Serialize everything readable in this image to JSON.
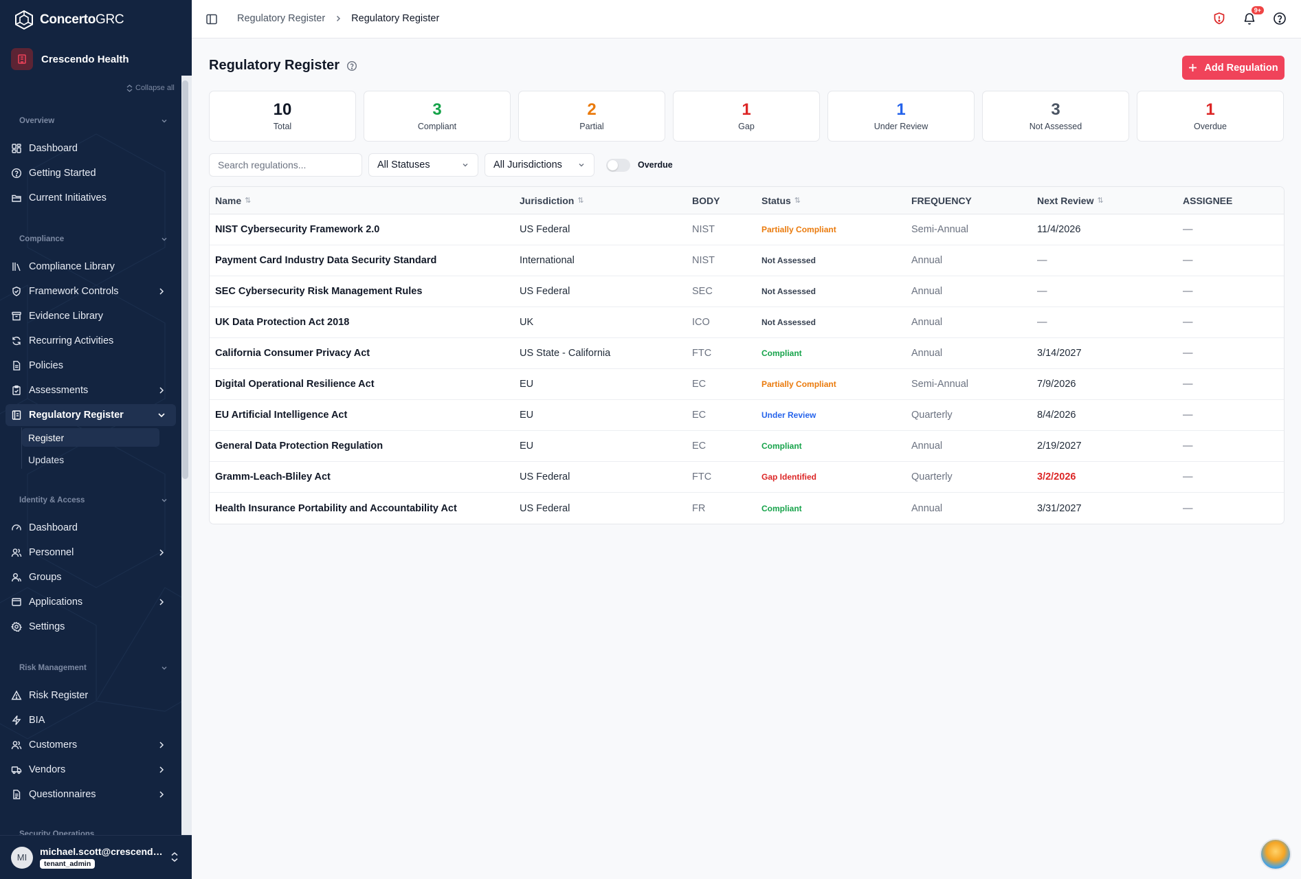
{
  "brand": {
    "name_bold": "Concerto",
    "name_thin": "GRC"
  },
  "tenant": {
    "name": "Crescendo Health"
  },
  "sidebar": {
    "collapse_all": "Collapse all",
    "sections": {
      "overview": "Overview",
      "compliance": "Compliance",
      "identity": "Identity & Access",
      "risk": "Risk Management",
      "security": "Security Operations"
    },
    "items": {
      "dashboard": "Dashboard",
      "getting_started": "Getting Started",
      "current_initiatives": "Current Initiatives",
      "compliance_library": "Compliance Library",
      "framework_controls": "Framework Controls",
      "evidence_library": "Evidence Library",
      "recurring_activities": "Recurring Activities",
      "policies": "Policies",
      "assessments": "Assessments",
      "regulatory_register": "Regulatory Register",
      "register": "Register",
      "updates": "Updates",
      "ia_dashboard": "Dashboard",
      "personnel": "Personnel",
      "groups": "Groups",
      "applications": "Applications",
      "settings": "Settings",
      "risk_register": "Risk Register",
      "bia": "BIA",
      "customers": "Customers",
      "vendors": "Vendors",
      "questionnaires": "Questionnaires"
    }
  },
  "user": {
    "email": "michael.scott@crescendohealth.com",
    "initials": "MI",
    "role": "tenant_admin"
  },
  "topbar": {
    "breadcrumb_parent": "Regulatory Register",
    "breadcrumb_current": "Regulatory Register",
    "notif_badge": "9+"
  },
  "page": {
    "title": "Regulatory Register",
    "add_label": "Add Regulation"
  },
  "stats": [
    {
      "value": "10",
      "label": "Total",
      "color": "#111827"
    },
    {
      "value": "3",
      "label": "Compliant",
      "color": "#16a34a"
    },
    {
      "value": "2",
      "label": "Partial",
      "color": "#ea7a0c"
    },
    {
      "value": "1",
      "label": "Gap",
      "color": "#dc2626"
    },
    {
      "value": "1",
      "label": "Under Review",
      "color": "#2563eb"
    },
    {
      "value": "3",
      "label": "Not Assessed",
      "color": "#4b5563"
    },
    {
      "value": "1",
      "label": "Overdue",
      "color": "#dc2626"
    }
  ],
  "filters": {
    "search_placeholder": "Search regulations...",
    "status_value": "All Statuses",
    "jurisdiction_value": "All Jurisdictions",
    "overdue_label": "Overdue"
  },
  "table": {
    "headers": {
      "name": "Name",
      "jurisdiction": "Jurisdiction",
      "body": "BODY",
      "status": "Status",
      "frequency": "FREQUENCY",
      "next_review": "Next Review",
      "assignee": "ASSIGNEE"
    },
    "rows": [
      {
        "name": "NIST Cybersecurity Framework 2.0",
        "jurisdiction": "US Federal",
        "body": "NIST",
        "status": "Partially Compliant",
        "status_color": "#ea7a0c",
        "frequency": "Semi-Annual",
        "next_review": "11/4/2026",
        "next_color": "#1f2937",
        "assignee": "—"
      },
      {
        "name": "Payment Card Industry Data Security Standard",
        "jurisdiction": "International",
        "body": "NIST",
        "status": "Not Assessed",
        "status_color": "#374151",
        "frequency": "Annual",
        "next_review": "—",
        "next_color": "#6b7280",
        "assignee": "—"
      },
      {
        "name": "SEC Cybersecurity Risk Management Rules",
        "jurisdiction": "US Federal",
        "body": "SEC",
        "status": "Not Assessed",
        "status_color": "#374151",
        "frequency": "Annual",
        "next_review": "—",
        "next_color": "#6b7280",
        "assignee": "—"
      },
      {
        "name": "UK Data Protection Act 2018",
        "jurisdiction": "UK",
        "body": "ICO",
        "status": "Not Assessed",
        "status_color": "#374151",
        "frequency": "Annual",
        "next_review": "—",
        "next_color": "#6b7280",
        "assignee": "—"
      },
      {
        "name": "California Consumer Privacy Act",
        "jurisdiction": "US State - California",
        "body": "FTC",
        "status": "Compliant",
        "status_color": "#16a34a",
        "frequency": "Annual",
        "next_review": "3/14/2027",
        "next_color": "#1f2937",
        "assignee": "—"
      },
      {
        "name": "Digital Operational Resilience Act",
        "jurisdiction": "EU",
        "body": "EC",
        "status": "Partially Compliant",
        "status_color": "#ea7a0c",
        "frequency": "Semi-Annual",
        "next_review": "7/9/2026",
        "next_color": "#1f2937",
        "assignee": "—"
      },
      {
        "name": "EU Artificial Intelligence Act",
        "jurisdiction": "EU",
        "body": "EC",
        "status": "Under Review",
        "status_color": "#2563eb",
        "frequency": "Quarterly",
        "next_review": "8/4/2026",
        "next_color": "#1f2937",
        "assignee": "—"
      },
      {
        "name": "General Data Protection Regulation",
        "jurisdiction": "EU",
        "body": "EC",
        "status": "Compliant",
        "status_color": "#16a34a",
        "frequency": "Annual",
        "next_review": "2/19/2027",
        "next_color": "#1f2937",
        "assignee": "—"
      },
      {
        "name": "Gramm-Leach-Bliley Act",
        "jurisdiction": "US Federal",
        "body": "FTC",
        "status": "Gap Identified",
        "status_color": "#dc2626",
        "frequency": "Quarterly",
        "next_review": "3/2/2026",
        "next_color": "#dc2626",
        "assignee": "—"
      },
      {
        "name": "Health Insurance Portability and Accountability Act",
        "jurisdiction": "US Federal",
        "body": "FR",
        "status": "Compliant",
        "status_color": "#16a34a",
        "frequency": "Annual",
        "next_review": "3/31/2027",
        "next_color": "#1f2937",
        "assignee": "—"
      }
    ]
  }
}
